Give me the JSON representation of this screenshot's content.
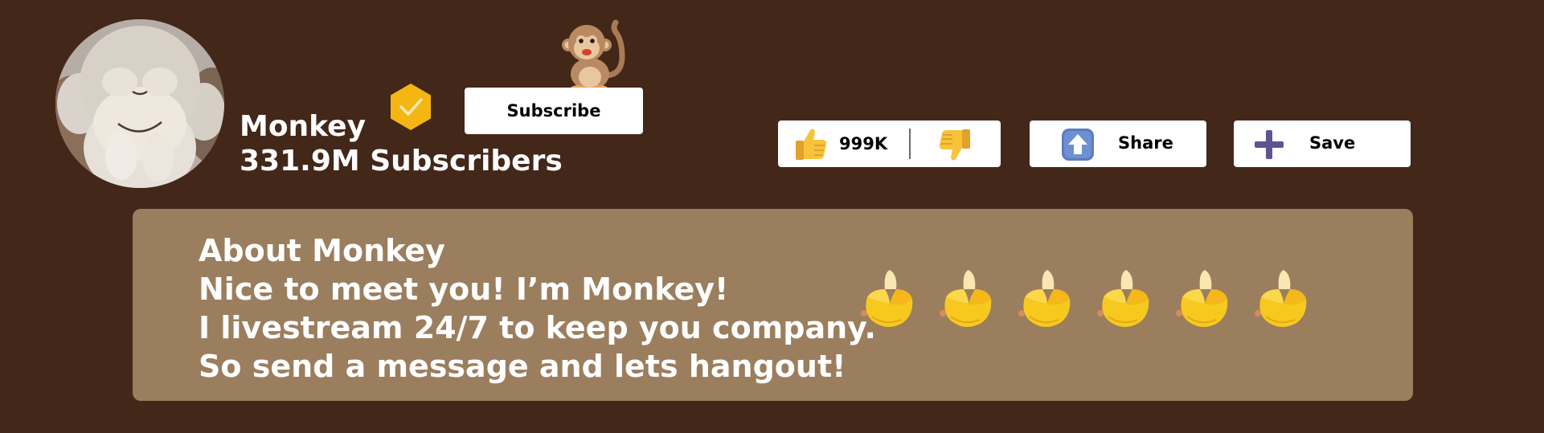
{
  "channel": {
    "name": "Monkey",
    "subscribers": "331.9M Subscribers"
  },
  "actions": {
    "subscribe_label": "Subscribe",
    "like_count": "999K",
    "share_label": "Share",
    "save_label": "Save"
  },
  "about": {
    "heading": "About Monkey",
    "lines": [
      "Nice to meet you! I’m Monkey!",
      "I livestream 24/7 to keep you company.",
      "So send a message and lets hangout!"
    ]
  },
  "decorations": {
    "banana_count": 6,
    "icons": [
      "monkey-icon",
      "verified-badge-icon",
      "thumbs-up-icon",
      "thumbs-down-icon",
      "share-up-arrow-icon",
      "plus-icon",
      "banana-icon"
    ]
  },
  "colors": {
    "background": "#432719",
    "about_panel": "#9b7e5e",
    "verified_badge": "#f5b614",
    "save_plus": "#5e5393",
    "share_icon": "#5b7dc1"
  }
}
